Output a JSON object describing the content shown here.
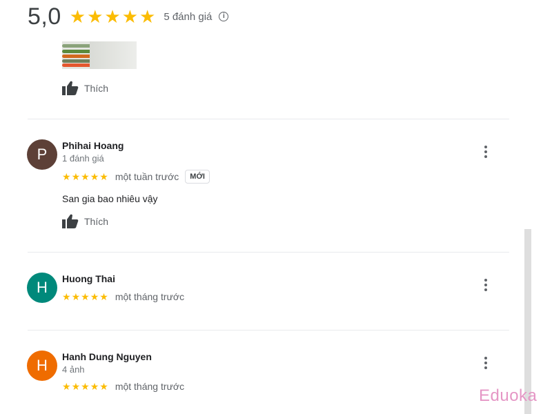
{
  "summary": {
    "rating": "5,0",
    "stars": 5,
    "review_count": "5 đánh giá",
    "info_icon": "info-icon"
  },
  "top_review": {
    "photo": "review-photo-thumbnail",
    "like_label": "Thích"
  },
  "reviews": [
    {
      "avatar_letter": "P",
      "avatar_color": "#5d4037",
      "name": "Phihai Hoang",
      "meta": "1 đánh giá",
      "stars": 5,
      "time": "một tuần trước",
      "badge": "MỚI",
      "text": "San gia bao nhiêu vậy",
      "like_label": "Thích"
    },
    {
      "avatar_letter": "H",
      "avatar_color": "#00897b",
      "name": "Huong Thai",
      "stars": 5,
      "time": "một tháng trước"
    },
    {
      "avatar_letter": "H",
      "avatar_color": "#ef6c00",
      "name": "Hanh Dung Nguyen",
      "meta": "4 ảnh",
      "stars": 5,
      "time": "một tháng trước"
    }
  ],
  "colors": {
    "star": "#fbbc04",
    "text_secondary": "#5f6368",
    "divider": "#e8eaed"
  },
  "watermark": "Eduoka"
}
